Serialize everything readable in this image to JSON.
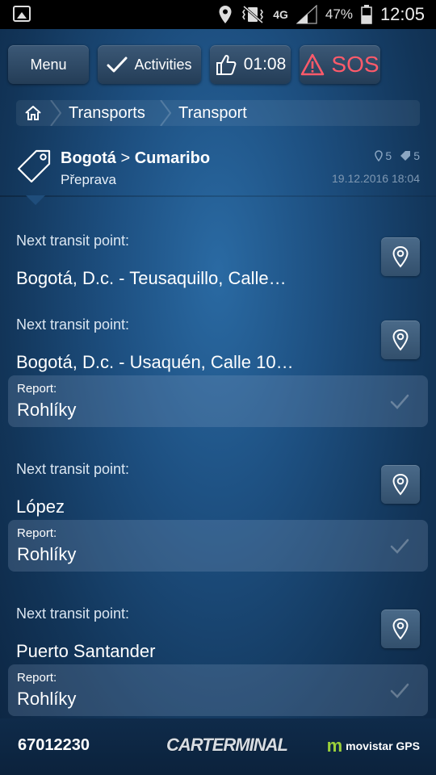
{
  "status_bar": {
    "network": "4G",
    "battery": "47%",
    "time": "12:05"
  },
  "toolbar": {
    "menu_label": "Menu",
    "activities_label": "Activities",
    "timer": "01:08",
    "sos_label": "SOS"
  },
  "breadcrumb": {
    "items": [
      "Transports",
      "Transport"
    ]
  },
  "transport": {
    "from": "Bogotá",
    "separator": ">",
    "to": "Cumaribo",
    "subtype": "Přeprava",
    "points_count": "5",
    "tags_count": "5",
    "date": "19.12.2016 18:04"
  },
  "transit_points": [
    {
      "label": "Next transit point:",
      "value": "Bogotá, D.c. - Teusaquillo, Calle…"
    },
    {
      "label": "Next transit point:",
      "value": "Bogotá, D.c. - Usaquén, Calle 10…",
      "report_label": "Report:",
      "report_value": "Rohlíky"
    },
    {
      "label": "Next transit point:",
      "value": "López",
      "report_label": "Report:",
      "report_value": "Rohlíky"
    },
    {
      "label": "Next transit point:",
      "value": "Puerto Santander",
      "report_label": "Report:",
      "report_value": "Rohlíky"
    }
  ],
  "footer": {
    "device_id": "67012230",
    "brand": "CARTERMINAL",
    "partner": "movistar GPS"
  },
  "colors": {
    "accent_sos": "#ff5a6a",
    "movistar_green": "#9bd03a"
  }
}
